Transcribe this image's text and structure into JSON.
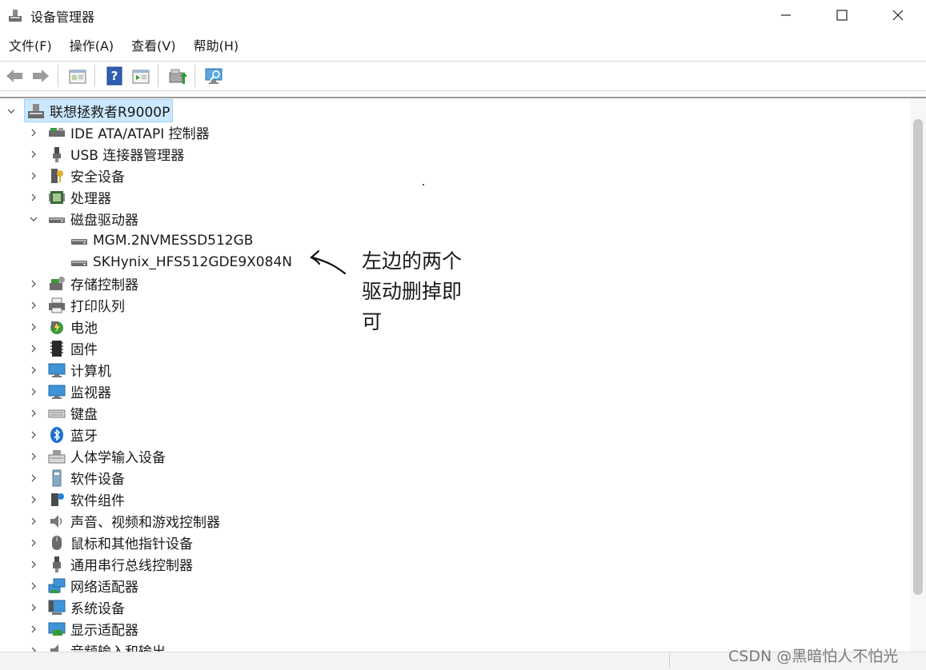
{
  "window": {
    "title": "设备管理器",
    "icon": "device-manager-icon"
  },
  "menu": [
    "文件(F)",
    "操作(A)",
    "查看(V)",
    "帮助(H)"
  ],
  "toolbar": [
    "back-arrow-icon",
    "forward-arrow-icon",
    "properties-icon",
    "help-icon",
    "show-hidden-icon",
    "update-driver-icon",
    "scan-hardware-icon"
  ],
  "tree": {
    "root": "联想拯救者R9000P",
    "items": [
      {
        "label": "IDE ATA/ATAPI 控制器",
        "icon": "ide-controller-icon",
        "expanded": false
      },
      {
        "label": "USB 连接器管理器",
        "icon": "usb-connector-icon",
        "expanded": false
      },
      {
        "label": "安全设备",
        "icon": "security-device-icon",
        "expanded": false
      },
      {
        "label": "处理器",
        "icon": "processor-icon",
        "expanded": false
      },
      {
        "label": "磁盘驱动器",
        "icon": "disk-drive-icon",
        "expanded": true
      },
      {
        "label": "MGM.2NVMESSD512GB",
        "icon": "disk-drive-icon",
        "child": true
      },
      {
        "label": "SKHynix_HFS512GDE9X084N",
        "icon": "disk-drive-icon",
        "child": true
      },
      {
        "label": "存储控制器",
        "icon": "storage-controller-icon",
        "expanded": false
      },
      {
        "label": "打印队列",
        "icon": "printer-icon",
        "expanded": false
      },
      {
        "label": "电池",
        "icon": "battery-icon",
        "expanded": false
      },
      {
        "label": "固件",
        "icon": "firmware-icon",
        "expanded": false
      },
      {
        "label": "计算机",
        "icon": "computer-icon",
        "expanded": false
      },
      {
        "label": "监视器",
        "icon": "monitor-icon",
        "expanded": false
      },
      {
        "label": "键盘",
        "icon": "keyboard-icon",
        "expanded": false
      },
      {
        "label": "蓝牙",
        "icon": "bluetooth-icon",
        "expanded": false
      },
      {
        "label": "人体学输入设备",
        "icon": "hid-icon",
        "expanded": false
      },
      {
        "label": "软件设备",
        "icon": "software-device-icon",
        "expanded": false
      },
      {
        "label": "软件组件",
        "icon": "software-component-icon",
        "expanded": false
      },
      {
        "label": "声音、视频和游戏控制器",
        "icon": "speaker-icon",
        "expanded": false
      },
      {
        "label": "鼠标和其他指针设备",
        "icon": "mouse-icon",
        "expanded": false
      },
      {
        "label": "通用串行总线控制器",
        "icon": "usb-icon",
        "expanded": false
      },
      {
        "label": "网络适配器",
        "icon": "network-adapter-icon",
        "expanded": false
      },
      {
        "label": "系统设备",
        "icon": "system-device-icon",
        "expanded": false
      },
      {
        "label": "显示适配器",
        "icon": "display-adapter-icon",
        "expanded": false
      },
      {
        "label": "音频输入和输出",
        "icon": "audio-io-icon",
        "expanded": false
      }
    ]
  },
  "annotation": {
    "text": "左边的两个驱动删掉即可"
  },
  "watermark": "CSDN @黑暗怕人不怕光",
  "colors": {
    "selection": "#cce8ff",
    "selection_border": "#99d1ff"
  }
}
